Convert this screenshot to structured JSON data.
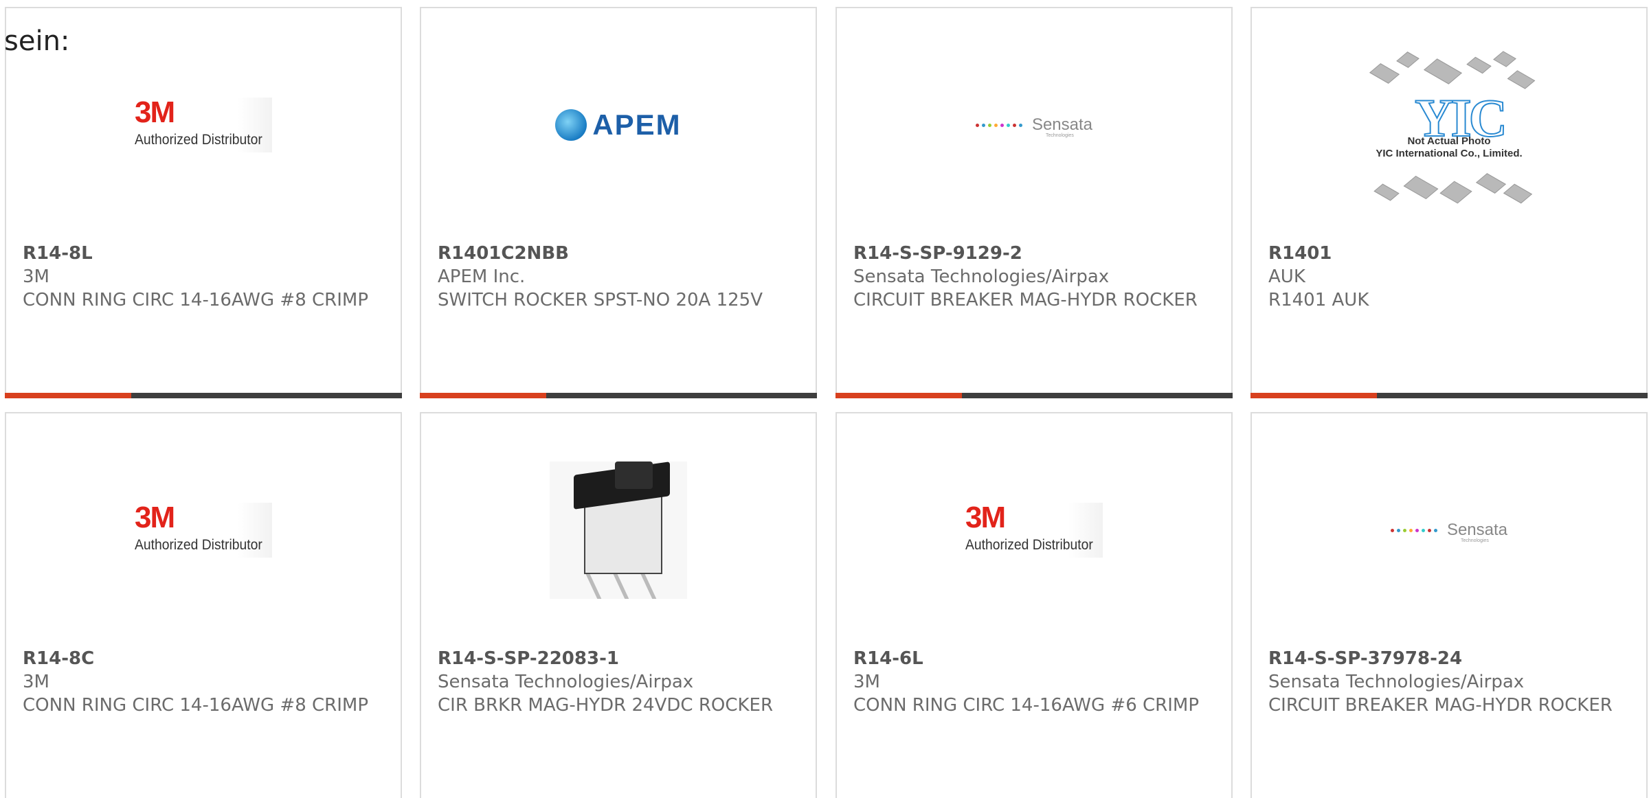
{
  "intro_text": "sein:",
  "products": [
    {
      "part_number": "R14-8L",
      "manufacturer": "3M",
      "description": "CONN RING CIRC 14-16AWG #8 CRIMP",
      "image": "3m-logo",
      "logo_text": "3M",
      "logo_sub": "Authorized Distributor"
    },
    {
      "part_number": "R1401C2NBB",
      "manufacturer": "APEM Inc.",
      "description": "SWITCH ROCKER SPST-NO 20A 125V",
      "image": "apem-logo",
      "logo_text": "APEM"
    },
    {
      "part_number": "R14-S-SP-9129-2",
      "manufacturer": "Sensata Technologies/Airpax",
      "description": "CIRCUIT BREAKER MAG-HYDR ROCKER",
      "image": "sensata-logo",
      "logo_text": "Sensata",
      "logo_sub": "Technologies"
    },
    {
      "part_number": "R1401",
      "manufacturer": "AUK",
      "description": "R1401 AUK",
      "image": "yic-placeholder",
      "logo_text": "YIC",
      "logo_note_1": "Not Actual Photo",
      "logo_note_2": "YIC International Co., Limited."
    },
    {
      "part_number": "R14-8C",
      "manufacturer": "3M",
      "description": "CONN RING CIRC 14-16AWG #8 CRIMP",
      "image": "3m-logo",
      "logo_text": "3M",
      "logo_sub": "Authorized Distributor"
    },
    {
      "part_number": "R14-S-SP-22083-1",
      "manufacturer": "Sensata Technologies/Airpax",
      "description": "CIR BRKR MAG-HYDR 24VDC ROCKER",
      "image": "switch-photo"
    },
    {
      "part_number": "R14-6L",
      "manufacturer": "3M",
      "description": "CONN RING CIRC 14-16AWG #6 CRIMP",
      "image": "3m-logo",
      "logo_text": "3M",
      "logo_sub": "Authorized Distributor"
    },
    {
      "part_number": "R14-S-SP-37978-24",
      "manufacturer": "Sensata Technologies/Airpax",
      "description": "CIRCUIT BREAKER MAG-HYDR ROCKER",
      "image": "sensata-logo",
      "logo_text": "Sensata",
      "logo_sub": "Technologies"
    }
  ],
  "colors": {
    "accent": "#d8401e",
    "bar": "#3e3e3e",
    "text": "#6b6b6b"
  }
}
